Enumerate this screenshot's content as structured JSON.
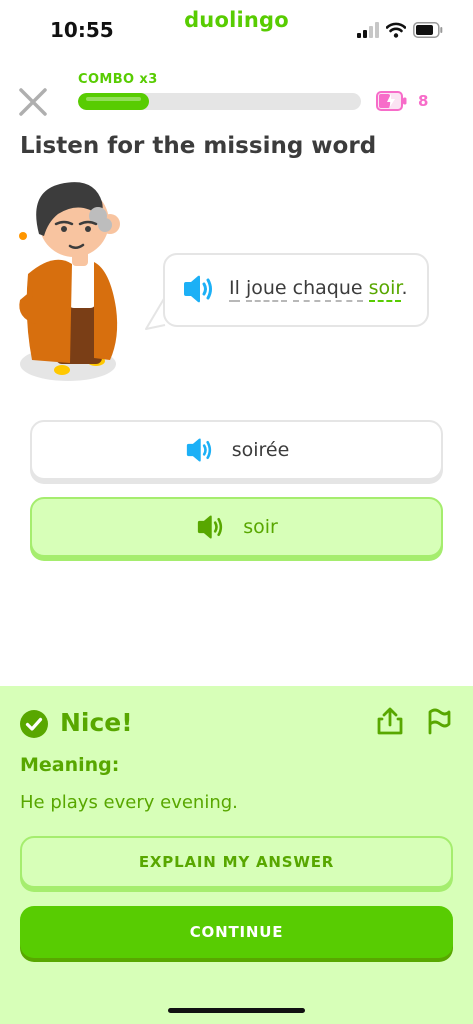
{
  "status_bar": {
    "time": "10:55",
    "brand": "duolingo",
    "icons": [
      "signal-icon",
      "wifi-icon",
      "battery-icon"
    ]
  },
  "header": {
    "combo_label": "COMBO x3",
    "progress_fraction": 0.25,
    "energy_count": "8"
  },
  "exercise": {
    "title": "Listen for the missing word",
    "sentence_words": [
      "Il",
      "joue",
      "chaque"
    ],
    "answer_word": "soir",
    "sentence_end": ".",
    "options": [
      {
        "label": "soirée",
        "state": "default"
      },
      {
        "label": "soir",
        "state": "selected-correct"
      }
    ]
  },
  "feedback": {
    "title": "Nice!",
    "meaning_label": "Meaning:",
    "meaning_text": "He plays every evening.",
    "explain_button": "EXPLAIN MY ANSWER",
    "continue_button": "CONTINUE"
  },
  "colors": {
    "brand_green": "#58cc02",
    "dark_green": "#58a700",
    "feedback_bg": "#d7ffb8",
    "speaker_blue": "#1cb0f6",
    "energy_pink": "#f76cc9",
    "text": "#3c3c3c"
  }
}
